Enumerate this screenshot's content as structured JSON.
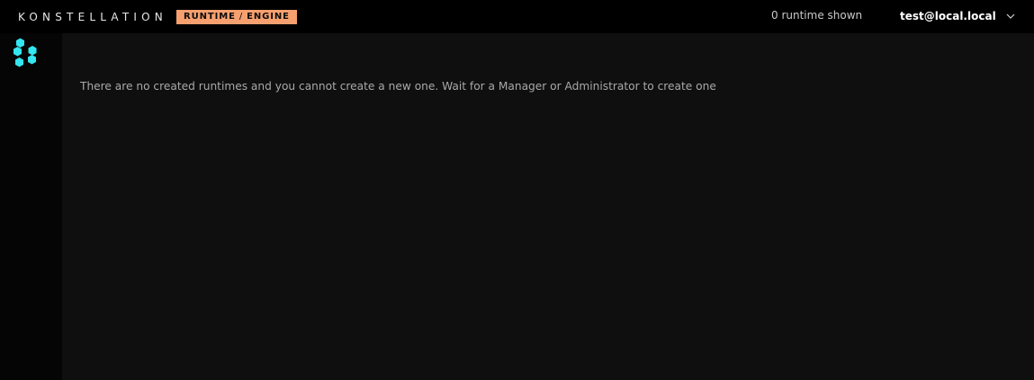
{
  "header": {
    "brand_name": "KONSTELLATION",
    "product_badge": {
      "left": "RUNTIME",
      "separator": "/",
      "right": "ENGINE"
    },
    "runtime_count": "0 runtime shown",
    "user_email": "test@local.local",
    "user_menu_icon": "chevron-down-icon"
  },
  "sidebar": {
    "logo_icon": "hexagon-cluster-icon"
  },
  "main": {
    "empty_message": "There are no created runtimes and you cannot create a new one. Wait for a Manager or Administrator to create one"
  },
  "colors": {
    "topbar_bg": "#000000",
    "sidebar_bg": "#050505",
    "main_bg": "#0f0f0f",
    "badge_bg": "#f6a070",
    "hex_accent": "#33e6f0",
    "text_muted": "#a9a9a9"
  }
}
